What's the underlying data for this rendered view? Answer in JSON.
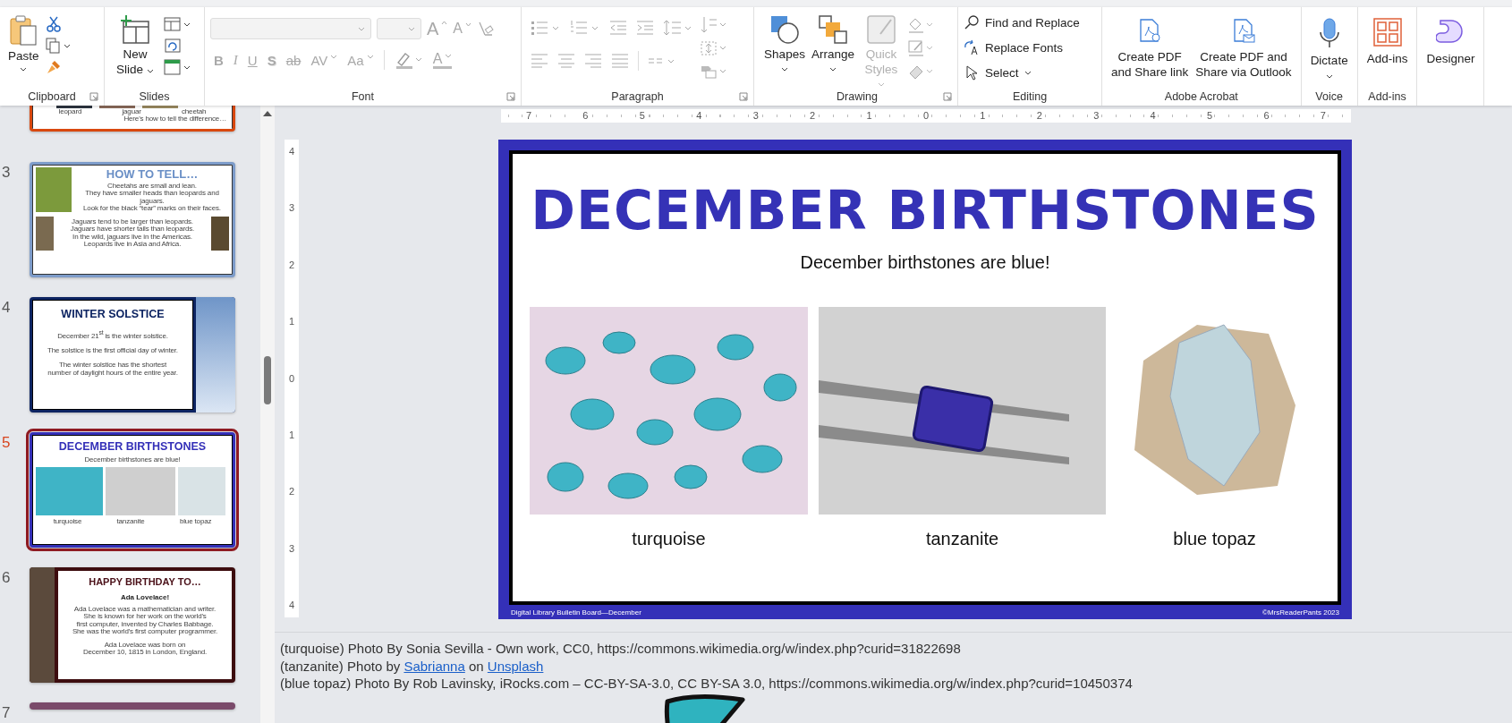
{
  "ribbon": {
    "groups": [
      {
        "kind": "clipboard",
        "label": "Clipboard",
        "paste": "Paste"
      },
      {
        "kind": "slides",
        "label": "Slides",
        "new_slide": "New Slide"
      },
      {
        "kind": "font",
        "label": "Font",
        "grow": "A",
        "shrink": "A",
        "formats": [
          {
            "kind": "bold",
            "text": "B"
          },
          {
            "kind": "italic",
            "text": "I"
          },
          {
            "kind": "underline",
            "text": "U"
          },
          {
            "kind": "shadow",
            "text": "S"
          },
          {
            "kind": "strike",
            "text": "ab"
          },
          {
            "kind": "spacing",
            "text": "AV"
          },
          {
            "kind": "case",
            "text": "Aa"
          }
        ],
        "color_letter": "A"
      },
      {
        "kind": "paragraph",
        "label": "Paragraph"
      },
      {
        "kind": "drawing",
        "label": "Drawing",
        "buttons": [
          {
            "kind": "shapes",
            "label": "Shapes",
            "disabled": false
          },
          {
            "kind": "arrange",
            "label": "Arrange",
            "disabled": false
          },
          {
            "kind": "styles",
            "label": "Quick Styles",
            "disabled": true
          }
        ]
      },
      {
        "kind": "editing",
        "label": "Editing",
        "items": [
          {
            "kind": "find",
            "label": "Find and Replace"
          },
          {
            "kind": "fonts",
            "label": "Replace Fonts"
          },
          {
            "kind": "select",
            "label": "Select"
          }
        ]
      },
      {
        "kind": "large",
        "label": "Adobe Acrobat",
        "buttons": [
          {
            "kind": "pdf-link",
            "label": "Create PDF\nand Share link"
          },
          {
            "kind": "pdf-mail",
            "label": "Create PDF and\nShare via Outlook"
          }
        ]
      },
      {
        "kind": "large",
        "label": "Voice",
        "buttons": [
          {
            "kind": "mic",
            "label": "Dictate"
          }
        ]
      },
      {
        "kind": "large",
        "label": "Add-ins",
        "buttons": [
          {
            "kind": "addins",
            "label": "Add-ins"
          }
        ]
      },
      {
        "kind": "large",
        "buttons": [
          {
            "kind": "designer",
            "label": "Designer"
          }
        ]
      }
    ]
  },
  "thumbnails": [
    {
      "kind": "animals",
      "selected": false,
      "captions": [
        "leopard",
        "jaguar",
        "cheetah"
      ],
      "text": "Here's how to tell the difference…"
    },
    {
      "kind": "howto",
      "number": "3",
      "selected": false,
      "title": "HOW TO TELL…",
      "lines_top": [
        "Cheetahs are small and lean.",
        "They have smaller heads than leopards and jaguars.",
        "Look for the black “tear” marks on their faces."
      ],
      "lines_bottom": [
        "Jaguars tend to be larger than leopards.",
        "Jaguars have shorter tails than leopards.",
        "In the wild, jaguars live in the Americas.",
        "Leopards live in Asia and Africa."
      ]
    },
    {
      "kind": "solstice",
      "number": "4",
      "selected": false,
      "title": "WINTER SOLSTICE",
      "lines": [
        "December 21$^{st}$ is the winter solstice.",
        "The solstice is the first official day of winter.",
        "The winter solstice has the shortest\nnumber of daylight hours of the entire year."
      ]
    },
    {
      "kind": "birthstones",
      "number": "5",
      "selected": true,
      "title": "DECEMBER BIRTHSTONES",
      "subtitle": "December birthstones are blue!",
      "captions": [
        "turquoise",
        "tanzanite",
        "blue topaz"
      ]
    },
    {
      "kind": "birthday",
      "number": "6",
      "selected": false,
      "title": "HAPPY BIRTHDAY TO…",
      "name": "Ada Lovelace!",
      "lines": [
        "Ada Lovelace was a mathematician and writer.",
        "She is known for her work on the world's",
        "first computer, invented by Charles Babbage.",
        "She was the world's first computer programmer."
      ],
      "lines_bottom": [
        "Ada Lovelace was born on",
        "December 10, 1815 in London, England."
      ]
    },
    {
      "kind": "next",
      "number": "7",
      "selected": false
    }
  ],
  "ruler": {
    "horizontal": [
      "7",
      "6",
      "5",
      "4",
      "3",
      "2",
      "1",
      "0",
      "1",
      "2",
      "3",
      "4",
      "5",
      "6",
      "7"
    ],
    "vertical": [
      "4",
      "3",
      "2",
      "1",
      "0",
      "1",
      "2",
      "3",
      "4"
    ]
  },
  "slide": {
    "title": "DECEMBER BIRTHSTONES",
    "subtitle": "December birthstones are blue!",
    "stones": [
      {
        "kind": "turquoise",
        "caption": "turquoise"
      },
      {
        "kind": "tanzanite",
        "caption": "tanzanite"
      },
      {
        "kind": "topaz",
        "caption": "blue topaz"
      }
    ],
    "footer_left": "Digital Library Bulletin Board—December",
    "footer_right": "©MrsReaderPants 2023"
  },
  "notes": [
    {
      "parts": [
        {
          "text": "(turquoise) Photo By Sonia Sevilla - Own work, CC0, https://commons.wikimedia.org/w/index.php?curid=31822698",
          "link": false
        }
      ]
    },
    {
      "parts": [
        {
          "text": "(tanzanite) Photo by ",
          "link": false
        },
        {
          "text": "Sabrianna",
          "link": true
        },
        {
          "text": " on ",
          "link": false
        },
        {
          "text": "Unsplash",
          "link": true
        }
      ]
    },
    {
      "parts": [
        {
          "text": "(blue topaz) Photo By Rob Lavinsky, iRocks.com – CC-BY-SA-3.0, CC BY-SA 3.0, https://commons.wikimedia.org/w/index.php?curid=10450374",
          "link": false
        }
      ]
    }
  ]
}
